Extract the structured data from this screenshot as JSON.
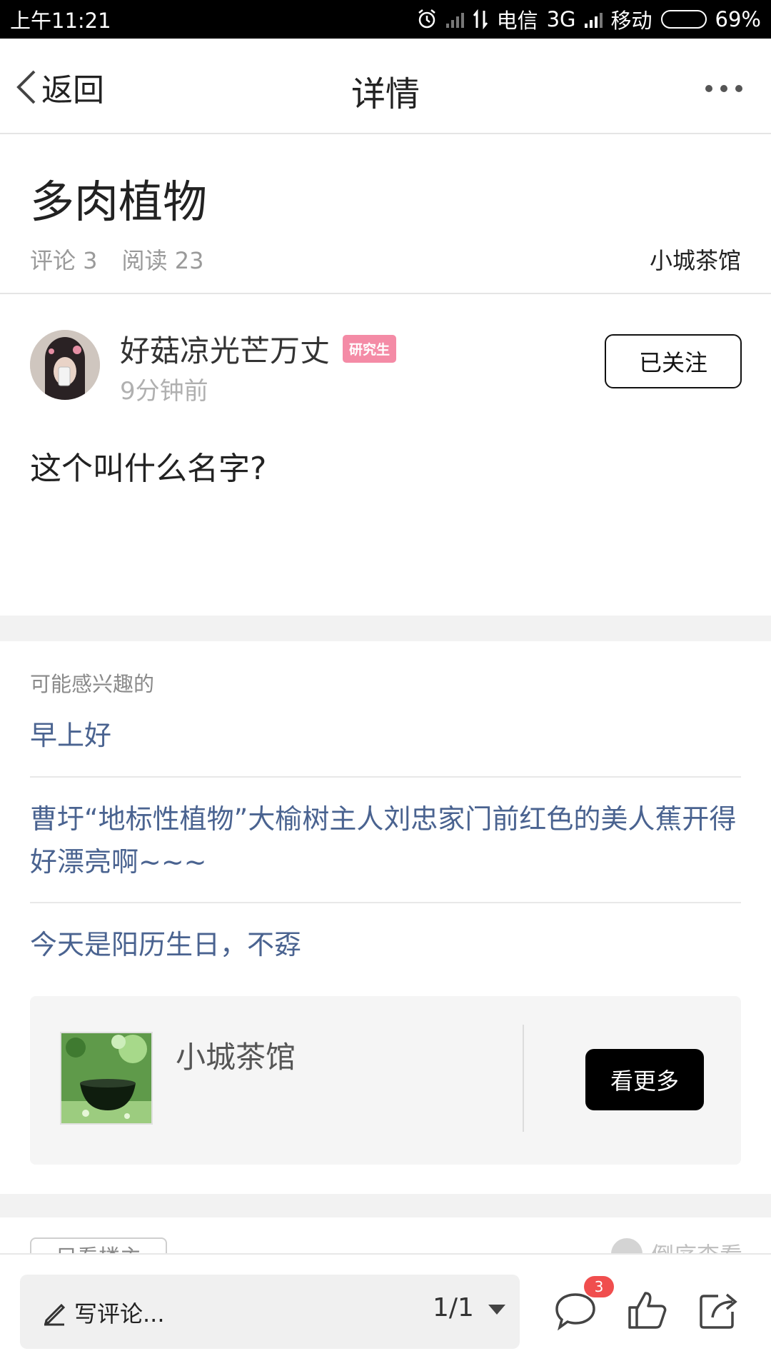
{
  "status_bar": {
    "time": "上午11:21",
    "carrier1": "电信",
    "network1": "3G",
    "carrier2": "移动",
    "battery": "69%",
    "battery_level": 0.69
  },
  "nav": {
    "back_label": "返回",
    "title": "详情"
  },
  "post": {
    "title": "多肉植物",
    "comments_label": "评论 3",
    "reads_label": "阅读 23",
    "source": "小城茶馆",
    "author": {
      "name": "好菇凉光芒万丈",
      "badge": "研究生",
      "time": "9分钟前",
      "follow_label": "已关注"
    },
    "body": "这个叫什么名字?"
  },
  "recommendations": {
    "heading": "可能感兴趣的",
    "items": [
      "早上好",
      "曹圩“地标性植物”大榆树主人刘忠家门前红色的美人蕉开得好漂亮啊~~~",
      "今天是阳历生日，不孬"
    ]
  },
  "club_card": {
    "name": "小城茶馆",
    "button_label": "看更多"
  },
  "filter_row": {
    "only_author": "只看楼主",
    "sort": "倒序查看"
  },
  "bottom_bar": {
    "comment_placeholder": "写评论...",
    "page_indicator": "1/1",
    "comment_count": "3"
  },
  "colors": {
    "link": "#4a6390",
    "badge": "#f48ba6",
    "notification": "#f04e4e"
  }
}
